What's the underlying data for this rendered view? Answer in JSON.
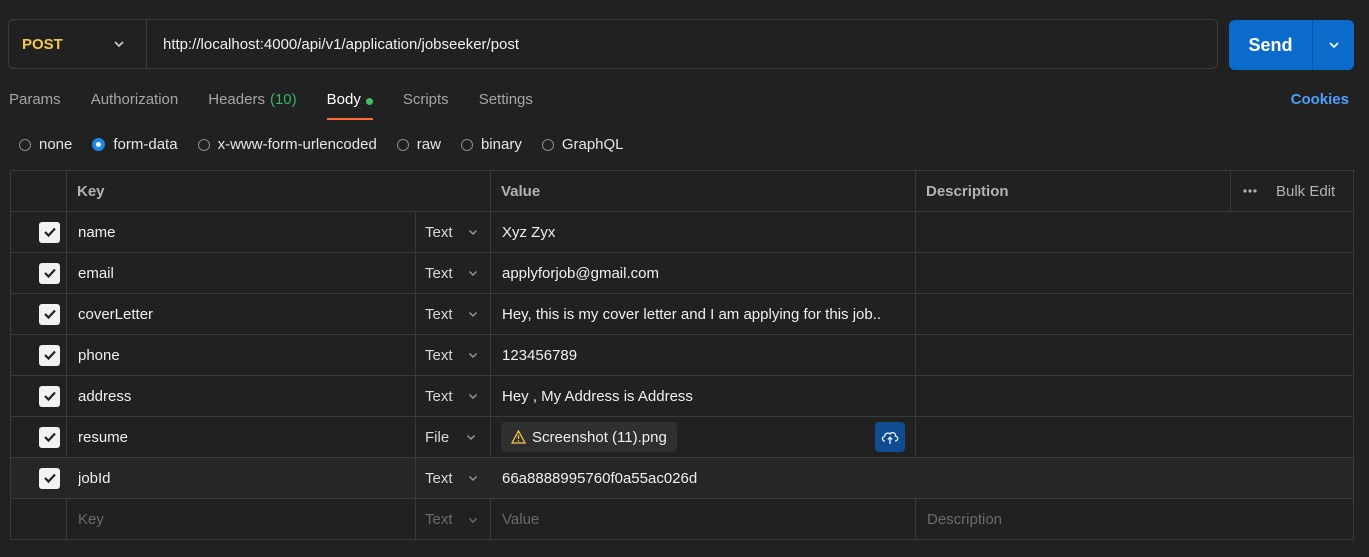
{
  "request": {
    "method": "POST",
    "url": "http://localhost:4000/api/v1/application/jobseeker/post",
    "send_label": "Send"
  },
  "tabs": [
    {
      "label": "Params"
    },
    {
      "label": "Authorization"
    },
    {
      "label": "Headers",
      "count": "(10)"
    },
    {
      "label": "Body",
      "active": true
    },
    {
      "label": "Scripts"
    },
    {
      "label": "Settings"
    }
  ],
  "cookies_label": "Cookies",
  "body_types": [
    {
      "label": "none"
    },
    {
      "label": "form-data",
      "selected": true
    },
    {
      "label": "x-www-form-urlencoded"
    },
    {
      "label": "raw"
    },
    {
      "label": "binary"
    },
    {
      "label": "GraphQL"
    }
  ],
  "table": {
    "headers": {
      "key": "Key",
      "value": "Value",
      "description": "Description",
      "bulk_edit": "Bulk Edit"
    },
    "rows": [
      {
        "key": "name",
        "type": "Text",
        "value": "Xyz Zyx"
      },
      {
        "key": "email",
        "type": "Text",
        "value": "applyforjob@gmail.com"
      },
      {
        "key": "coverLetter",
        "type": "Text",
        "value": "Hey, this is my cover letter and I am applying for this job.."
      },
      {
        "key": "phone",
        "type": "Text",
        "value": "123456789"
      },
      {
        "key": "address",
        "type": "Text",
        "value": "Hey , My Address is Address"
      },
      {
        "key": "resume",
        "type": "File",
        "value": "Screenshot (11).png"
      },
      {
        "key": "jobId",
        "type": "Text",
        "value": "66a8888995760f0a55ac026d"
      }
    ],
    "new_row": {
      "key_placeholder": "Key",
      "type": "Text",
      "value_placeholder": "Value",
      "description_placeholder": "Description"
    }
  },
  "colors": {
    "method": "#f5c84b",
    "send": "#0b6bcb",
    "active_tab": "#ff6c37",
    "cookies": "#4a9fff",
    "headers_count": "#39b36b"
  }
}
